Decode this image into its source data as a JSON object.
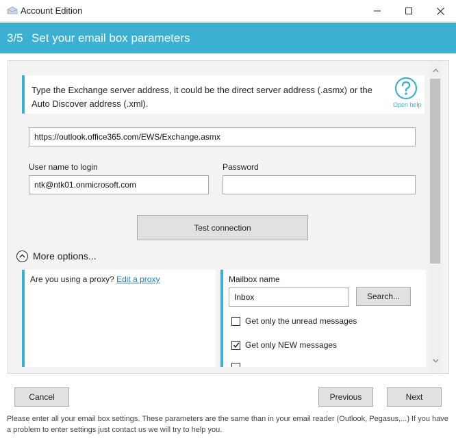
{
  "window": {
    "title": "Account Edition",
    "minimize_icon": "minimize-icon",
    "maximize_icon": "maximize-icon",
    "close_icon": "close-icon"
  },
  "header": {
    "step": "3/5",
    "title": "Set your email box parameters",
    "background_color": "#3cb0d0"
  },
  "info": {
    "text": "Type the Exchange server address, it could be the direct server address (.asmx) or the Auto Discover address (.xml).",
    "help_label": "Open help",
    "help_icon": "question-circle-icon"
  },
  "server": {
    "value": "https://outlook.office365.com/EWS/Exchange.asmx"
  },
  "username": {
    "label": "User name to login",
    "value": "ntk@ntk01.onmicrosoft.com"
  },
  "password": {
    "label": "Password",
    "value": ""
  },
  "test_button": "Test connection",
  "more_options": {
    "label": "More options...",
    "icon": "chevron-up-circle-icon"
  },
  "proxy": {
    "question": "Are you using a proxy?",
    "link": "Edit a proxy"
  },
  "mailbox": {
    "label": "Mailbox name",
    "value": "Inbox",
    "search_button": "Search...",
    "options": [
      {
        "label": "Get only the unread messages",
        "checked": false
      },
      {
        "label": "Get only NEW messages",
        "checked": true
      }
    ]
  },
  "footer": {
    "cancel": "Cancel",
    "previous": "Previous",
    "next": "Next",
    "note": "Please enter all your email box settings. These parameters are the same than in your email reader (Outlook, Pegasus,...) If you have a problem to enter settings just contact us we will try to help you."
  }
}
